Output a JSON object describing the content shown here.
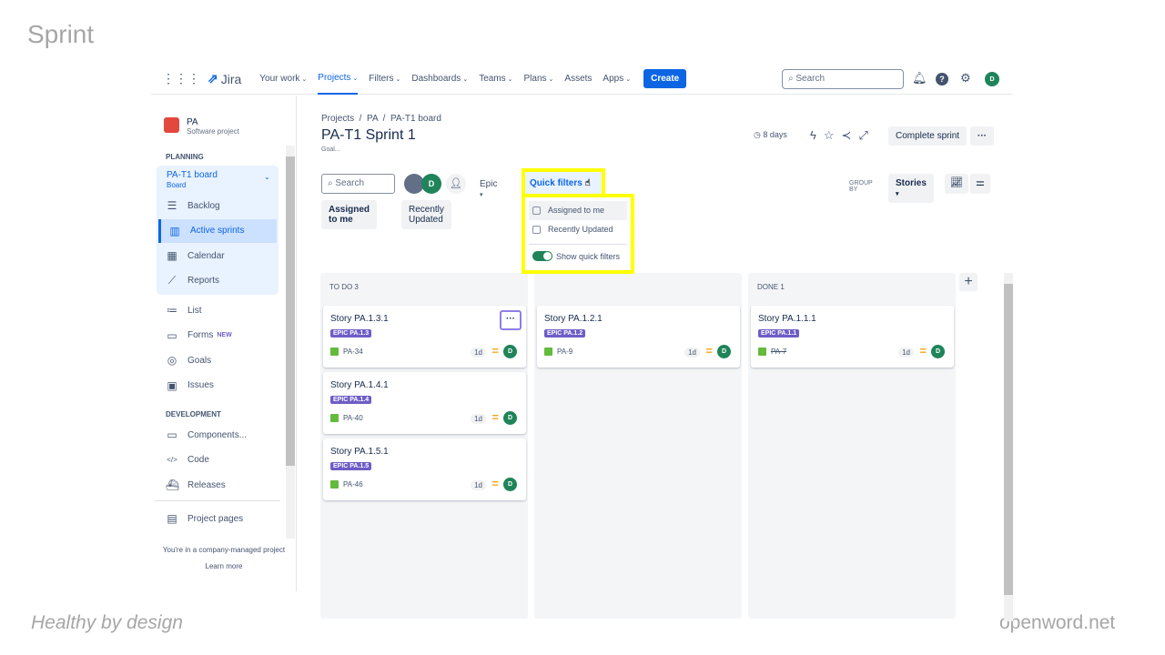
{
  "slide": {
    "title": "Sprint",
    "footer_left": "Healthy by design",
    "footer_right": "openword.net"
  },
  "nav": {
    "logo": "Jira",
    "items": [
      "Your work",
      "Projects",
      "Filters",
      "Dashboards",
      "Teams",
      "Plans",
      "Assets",
      "Apps"
    ],
    "create": "Create",
    "search_placeholder": "Search",
    "avatar": "D"
  },
  "sidebar": {
    "project_name": "PA",
    "project_type": "Software project",
    "planning": "PLANNING",
    "board_name": "PA-T1 board",
    "board_sub": "Board",
    "planning_items": [
      {
        "label": "Backlog",
        "icon": "backlog-icon"
      },
      {
        "label": "Active sprints",
        "icon": "board-icon"
      },
      {
        "label": "Calendar",
        "icon": "calendar-icon"
      },
      {
        "label": "Reports",
        "icon": "reports-icon"
      }
    ],
    "other_items": [
      {
        "label": "List",
        "icon": "list-icon"
      },
      {
        "label": "Forms",
        "icon": "forms-icon",
        "badge": "NEW"
      },
      {
        "label": "Goals",
        "icon": "goals-icon"
      },
      {
        "label": "Issues",
        "icon": "issues-icon"
      }
    ],
    "development": "DEVELOPMENT",
    "dev_items": [
      {
        "label": "Components...",
        "icon": "components-icon"
      },
      {
        "label": "Code",
        "icon": "code-icon"
      },
      {
        "label": "Releases",
        "icon": "releases-icon"
      }
    ],
    "project_pages": "Project pages",
    "company_note": "You're in a company-managed project",
    "learn_more": "Learn more"
  },
  "main": {
    "breadcrumb": [
      "Projects",
      "PA",
      "PA-T1 board"
    ],
    "title": "PA-T1 Sprint 1",
    "goal": "Goal...",
    "days": "8 days",
    "complete_sprint": "Complete sprint",
    "search_placeholder": "Search",
    "avatar": "D",
    "epic": "Epic",
    "quick_filters": "Quick filters",
    "group_by": "GROUP BY",
    "group_value": "Stories",
    "chips": [
      "Assigned to me",
      "Recently Updated"
    ]
  },
  "dropdown": {
    "options": [
      "Assigned to me",
      "Recently Updated"
    ],
    "toggle_label": "Show quick filters",
    "toggle_on": true
  },
  "columns": [
    {
      "title": "TO DO 3",
      "cards": [
        {
          "title": "Story PA.1.3.1",
          "epic": "EPIC PA.1.3",
          "key": "PA-34",
          "est": "1d",
          "av": "D"
        },
        {
          "title": "Story PA.1.4.1",
          "epic": "EPIC PA.1.4",
          "key": "PA-40",
          "est": "1d",
          "av": "D"
        },
        {
          "title": "Story PA.1.5.1",
          "epic": "EPIC PA.1.5",
          "key": "PA-46",
          "est": "1d",
          "av": "D"
        }
      ]
    },
    {
      "title": "",
      "cards": [
        {
          "title": "Story PA.1.2.1",
          "epic": "EPIC PA.1.2",
          "key": "PA-9",
          "est": "1d",
          "av": "D"
        }
      ]
    },
    {
      "title": "DONE 1",
      "cards": [
        {
          "title": "Story PA.1.1.1",
          "epic": "EPIC PA.1.1",
          "key": "PA-7",
          "est": "1d",
          "av": "D",
          "done": true
        }
      ]
    }
  ]
}
